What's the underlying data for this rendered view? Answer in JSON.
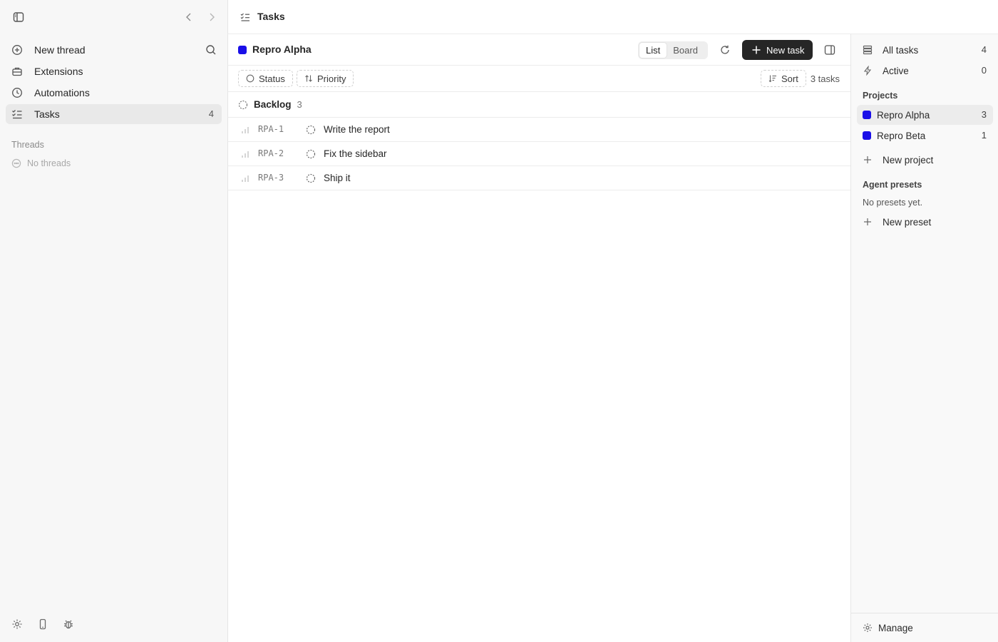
{
  "sidebar": {
    "nav": [
      {
        "label": "New thread",
        "icon": "plus-circle-icon"
      },
      {
        "label": "Extensions",
        "icon": "briefcase-icon"
      },
      {
        "label": "Automations",
        "icon": "clock-icon"
      },
      {
        "label": "Tasks",
        "icon": "checklist-icon",
        "count": "4",
        "active": true
      }
    ],
    "threads_title": "Threads",
    "no_threads": "No threads"
  },
  "header": {
    "title": "Tasks"
  },
  "main": {
    "project": {
      "name": "Repro Alpha",
      "color": "#1a0fe8"
    },
    "view_toggle": {
      "options": [
        "List",
        "Board"
      ],
      "selected": "List"
    },
    "new_task_label": "New task",
    "filters": {
      "status": "Status",
      "priority": "Priority",
      "sort": "Sort",
      "task_count": "3 tasks"
    },
    "group": {
      "name": "Backlog",
      "count": "3"
    },
    "tasks": [
      {
        "id": "RPA-1",
        "title": "Write the report"
      },
      {
        "id": "RPA-2",
        "title": "Fix the sidebar"
      },
      {
        "id": "RPA-3",
        "title": "Ship it"
      }
    ]
  },
  "right_panel": {
    "all_tasks": {
      "label": "All tasks",
      "count": "4"
    },
    "active": {
      "label": "Active",
      "count": "0"
    },
    "projects_title": "Projects",
    "projects": [
      {
        "name": "Repro Alpha",
        "count": "3",
        "color": "#1a0fe8",
        "active": true
      },
      {
        "name": "Repro Beta",
        "count": "1",
        "color": "#1a0fe8"
      }
    ],
    "new_project": "New project",
    "agent_presets_title": "Agent presets",
    "no_presets": "No presets yet.",
    "new_preset": "New preset",
    "manage": "Manage"
  },
  "colors": {
    "accent": "#1a0fe8",
    "primary_button": "#262626"
  }
}
